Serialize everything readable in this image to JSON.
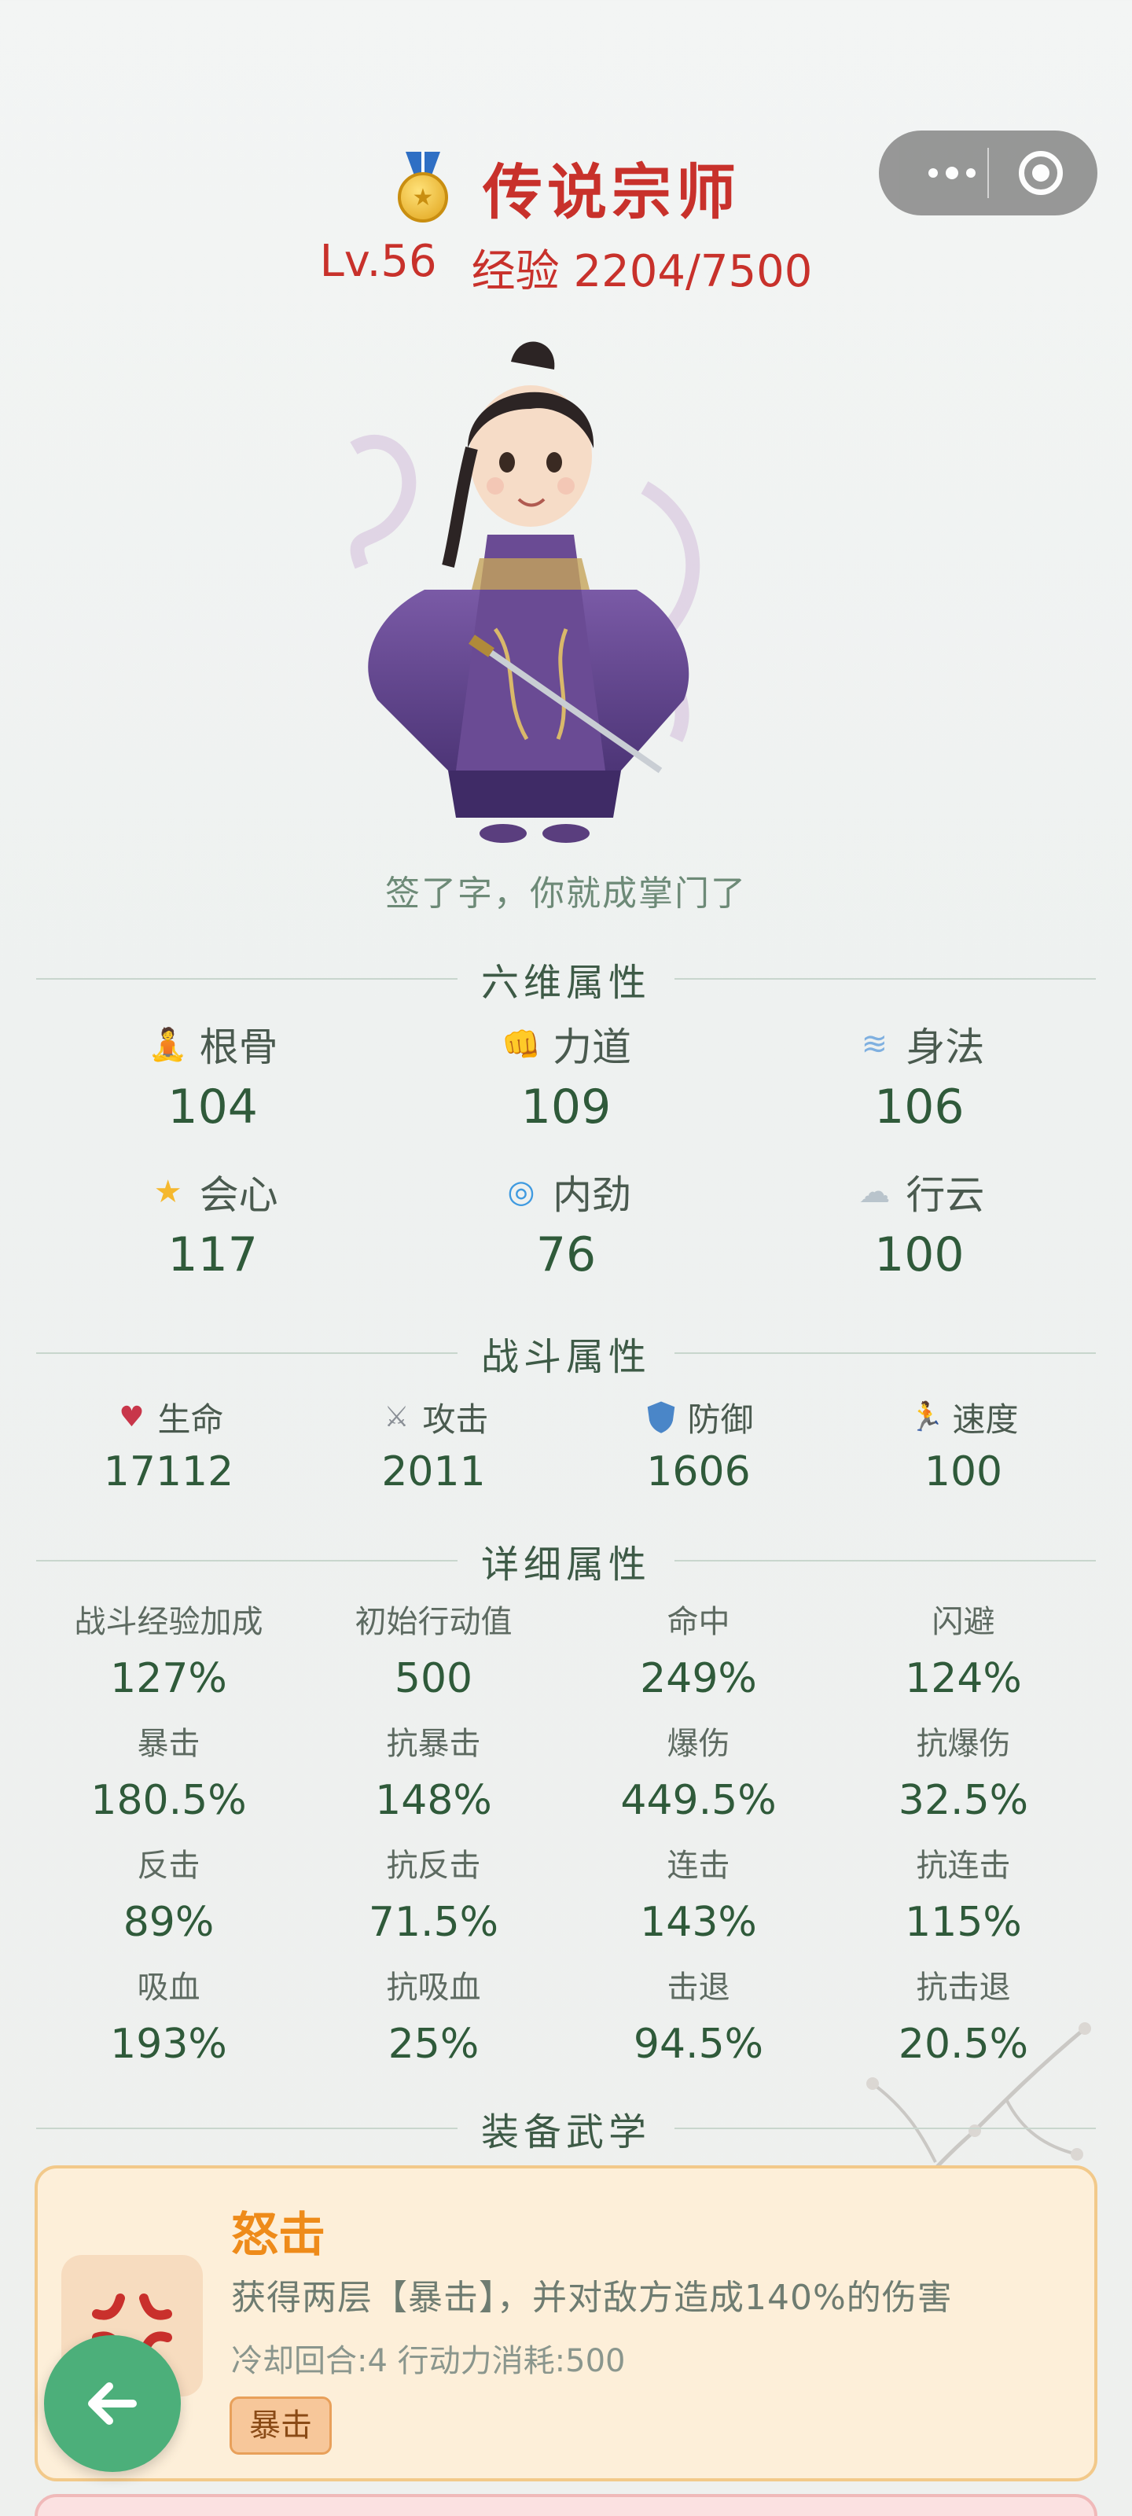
{
  "header": {
    "title": "传说宗师",
    "level": "Lv.56",
    "exp": "经验 2204/7500"
  },
  "motto": "签了字，你就成掌门了",
  "sections": {
    "six": "六维属性",
    "combat": "战斗属性",
    "detail": "详细属性",
    "skills": "装备武学"
  },
  "six_attrs": [
    {
      "name": "根骨",
      "value": "104",
      "icon": "meditation-icon"
    },
    {
      "name": "力道",
      "value": "109",
      "icon": "fist-icon"
    },
    {
      "name": "身法",
      "value": "106",
      "icon": "wind-icon"
    },
    {
      "name": "会心",
      "value": "117",
      "icon": "star-icon"
    },
    {
      "name": "内劲",
      "value": "76",
      "icon": "swirl-icon"
    },
    {
      "name": "行云",
      "value": "100",
      "icon": "cloud-icon"
    }
  ],
  "combat_attrs": [
    {
      "name": "生命",
      "value": "17112",
      "icon": "heart-icon"
    },
    {
      "name": "攻击",
      "value": "2011",
      "icon": "crossed-swords-icon"
    },
    {
      "name": "防御",
      "value": "1606",
      "icon": "shield-icon"
    },
    {
      "name": "速度",
      "value": "100",
      "icon": "runner-icon"
    }
  ],
  "detail_attrs": [
    {
      "name": "战斗经验加成",
      "value": "127%"
    },
    {
      "name": "初始行动值",
      "value": "500"
    },
    {
      "name": "命中",
      "value": "249%"
    },
    {
      "name": "闪避",
      "value": "124%"
    },
    {
      "name": "暴击",
      "value": "180.5%"
    },
    {
      "name": "抗暴击",
      "value": "148%"
    },
    {
      "name": "爆伤",
      "value": "449.5%"
    },
    {
      "name": "抗爆伤",
      "value": "32.5%"
    },
    {
      "name": "反击",
      "value": "89%"
    },
    {
      "name": "抗反击",
      "value": "71.5%"
    },
    {
      "name": "连击",
      "value": "143%"
    },
    {
      "name": "抗连击",
      "value": "115%"
    },
    {
      "name": "吸血",
      "value": "193%"
    },
    {
      "name": "抗吸血",
      "value": "25%"
    },
    {
      "name": "击退",
      "value": "94.5%"
    },
    {
      "name": "抗击退",
      "value": "20.5%"
    }
  ],
  "skill": {
    "name": "怒击",
    "desc": "获得两层【暴击】，并对敌方造成140%的伤害",
    "meta": "冷却回合:4  行动力消耗:500",
    "tag": "暴击",
    "icon": "anger-icon"
  },
  "colors": {
    "title_red": "#c8312b",
    "value_green": "#2f5a3a",
    "skill_orange": "#ee8b1a",
    "back_green": "#4caf7a"
  }
}
